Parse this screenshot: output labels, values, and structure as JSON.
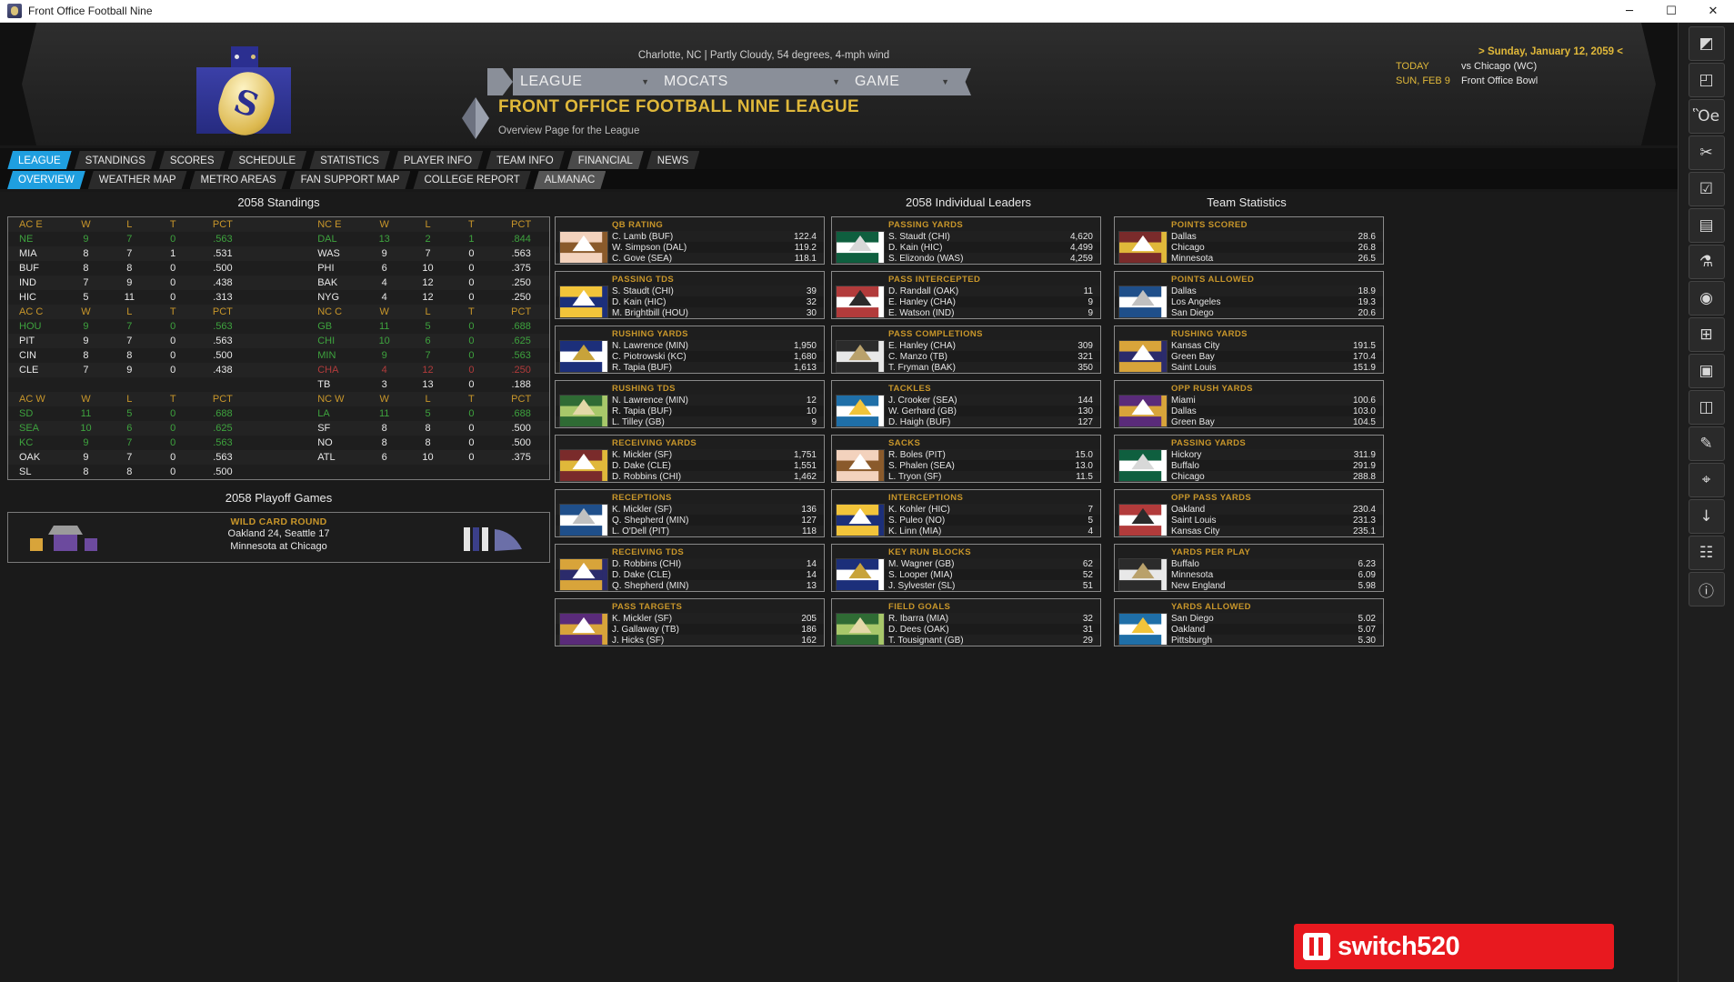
{
  "window": {
    "title": "Front Office Football Nine",
    "minimize": "─",
    "maximize": "☐",
    "close": "✕"
  },
  "header": {
    "weather": "Charlotte, NC | Partly Cloudy, 54 degrees, 4-mph wind",
    "nav": [
      {
        "label": "LEAGUE",
        "caret": "▼"
      },
      {
        "label": "MOCATS",
        "caret": "▼"
      },
      {
        "label": "GAME",
        "caret": "▼"
      }
    ],
    "league_title": "FRONT OFFICE FOOTBALL NINE LEAGUE",
    "league_sub": "Overview Page for the League",
    "date": {
      "current": "> Sunday, January 12, 2059 <",
      "rows": [
        {
          "key": "TODAY",
          "value": "vs Chicago (WC)"
        },
        {
          "key": "SUN, FEB 9",
          "value": "Front Office Bowl"
        }
      ]
    }
  },
  "tabs_primary": [
    {
      "label": "LEAGUE",
      "state": "active"
    },
    {
      "label": "STANDINGS",
      "state": "normal"
    },
    {
      "label": "SCORES",
      "state": "normal"
    },
    {
      "label": "SCHEDULE",
      "state": "normal"
    },
    {
      "label": "STATISTICS",
      "state": "normal"
    },
    {
      "label": "PLAYER INFO",
      "state": "normal"
    },
    {
      "label": "TEAM INFO",
      "state": "normal"
    },
    {
      "label": "FINANCIAL",
      "state": "hl"
    },
    {
      "label": "NEWS",
      "state": "normal"
    }
  ],
  "tabs_secondary": [
    {
      "label": "OVERVIEW",
      "state": "active"
    },
    {
      "label": "WEATHER MAP",
      "state": "normal"
    },
    {
      "label": "METRO AREAS",
      "state": "normal"
    },
    {
      "label": "FAN SUPPORT MAP",
      "state": "normal"
    },
    {
      "label": "COLLEGE REPORT",
      "state": "normal"
    },
    {
      "label": "ALMANAC",
      "state": "hl"
    }
  ],
  "standings": {
    "title": "2058 Standings",
    "columns": [
      "W",
      "L",
      "T",
      "PCT"
    ],
    "groups": [
      {
        "left": {
          "name": "AC E",
          "teams": [
            {
              "team": "NE",
              "color": "green",
              "w": "9",
              "l": "7",
              "t": "0",
              "pct": ".563"
            },
            {
              "team": "MIA",
              "color": "white",
              "w": "8",
              "l": "7",
              "t": "1",
              "pct": ".531"
            },
            {
              "team": "BUF",
              "color": "white",
              "w": "8",
              "l": "8",
              "t": "0",
              "pct": ".500"
            },
            {
              "team": "IND",
              "color": "white",
              "w": "7",
              "l": "9",
              "t": "0",
              "pct": ".438"
            },
            {
              "team": "HIC",
              "color": "white",
              "w": "5",
              "l": "11",
              "t": "0",
              "pct": ".313"
            }
          ]
        },
        "right": {
          "name": "NC E",
          "teams": [
            {
              "team": "DAL",
              "color": "green",
              "w": "13",
              "l": "2",
              "t": "1",
              "pct": ".844"
            },
            {
              "team": "WAS",
              "color": "white",
              "w": "9",
              "l": "7",
              "t": "0",
              "pct": ".563"
            },
            {
              "team": "PHI",
              "color": "white",
              "w": "6",
              "l": "10",
              "t": "0",
              "pct": ".375"
            },
            {
              "team": "BAK",
              "color": "white",
              "w": "4",
              "l": "12",
              "t": "0",
              "pct": ".250"
            },
            {
              "team": "NYG",
              "color": "white",
              "w": "4",
              "l": "12",
              "t": "0",
              "pct": ".250"
            }
          ]
        }
      },
      {
        "left": {
          "name": "AC C",
          "teams": [
            {
              "team": "HOU",
              "color": "green",
              "w": "9",
              "l": "7",
              "t": "0",
              "pct": ".563"
            },
            {
              "team": "PIT",
              "color": "white",
              "w": "9",
              "l": "7",
              "t": "0",
              "pct": ".563"
            },
            {
              "team": "CIN",
              "color": "white",
              "w": "8",
              "l": "8",
              "t": "0",
              "pct": ".500"
            },
            {
              "team": "CLE",
              "color": "white",
              "w": "7",
              "l": "9",
              "t": "0",
              "pct": ".438"
            },
            {
              "team": "",
              "color": "white",
              "w": "",
              "l": "",
              "t": "",
              "pct": ""
            }
          ]
        },
        "right": {
          "name": "NC C",
          "teams": [
            {
              "team": "GB",
              "color": "green",
              "w": "11",
              "l": "5",
              "t": "0",
              "pct": ".688"
            },
            {
              "team": "CHI",
              "color": "green",
              "w": "10",
              "l": "6",
              "t": "0",
              "pct": ".625"
            },
            {
              "team": "MIN",
              "color": "green",
              "w": "9",
              "l": "7",
              "t": "0",
              "pct": ".563"
            },
            {
              "team": "CHA",
              "color": "red",
              "w": "4",
              "l": "12",
              "t": "0",
              "pct": ".250"
            },
            {
              "team": "TB",
              "color": "white",
              "w": "3",
              "l": "13",
              "t": "0",
              "pct": ".188"
            }
          ]
        }
      },
      {
        "left": {
          "name": "AC W",
          "teams": [
            {
              "team": "SD",
              "color": "green",
              "w": "11",
              "l": "5",
              "t": "0",
              "pct": ".688"
            },
            {
              "team": "SEA",
              "color": "green",
              "w": "10",
              "l": "6",
              "t": "0",
              "pct": ".625"
            },
            {
              "team": "KC",
              "color": "green",
              "w": "9",
              "l": "7",
              "t": "0",
              "pct": ".563"
            },
            {
              "team": "OAK",
              "color": "white",
              "w": "9",
              "l": "7",
              "t": "0",
              "pct": ".563"
            },
            {
              "team": "SL",
              "color": "white",
              "w": "8",
              "l": "8",
              "t": "0",
              "pct": ".500"
            }
          ]
        },
        "right": {
          "name": "NC W",
          "teams": [
            {
              "team": "LA",
              "color": "green",
              "w": "11",
              "l": "5",
              "t": "0",
              "pct": ".688"
            },
            {
              "team": "SF",
              "color": "white",
              "w": "8",
              "l": "8",
              "t": "0",
              "pct": ".500"
            },
            {
              "team": "NO",
              "color": "white",
              "w": "8",
              "l": "8",
              "t": "0",
              "pct": ".500"
            },
            {
              "team": "ATL",
              "color": "white",
              "w": "6",
              "l": "10",
              "t": "0",
              "pct": ".375"
            },
            {
              "team": "",
              "color": "white",
              "w": "",
              "l": "",
              "t": "",
              "pct": ""
            }
          ]
        }
      }
    ]
  },
  "playoffs": {
    "title": "2058 Playoff Games",
    "round": "WILD CARD ROUND",
    "games": [
      "Oakland 24, Seattle 17",
      "Minnesota at Chicago"
    ]
  },
  "leaders": {
    "title": "2058 Individual Leaders",
    "column1": [
      {
        "category": "QB RATING",
        "rows": [
          {
            "name": "C. Lamb (BUF)",
            "value": "122.4"
          },
          {
            "name": "W. Simpson (DAL)",
            "value": "119.2"
          },
          {
            "name": "C. Gove (SEA)",
            "value": "118.1"
          }
        ]
      },
      {
        "category": "PASSING TDS",
        "rows": [
          {
            "name": "S. Staudt (CHI)",
            "value": "39"
          },
          {
            "name": "D. Kain (HIC)",
            "value": "32"
          },
          {
            "name": "M. Brightbill (HOU)",
            "value": "30"
          }
        ]
      },
      {
        "category": "RUSHING YARDS",
        "rows": [
          {
            "name": "N. Lawrence (MIN)",
            "value": "1,950"
          },
          {
            "name": "C. Piotrowski (KC)",
            "value": "1,680"
          },
          {
            "name": "R. Tapia (BUF)",
            "value": "1,613"
          }
        ]
      },
      {
        "category": "RUSHING TDS",
        "rows": [
          {
            "name": "N. Lawrence (MIN)",
            "value": "12"
          },
          {
            "name": "R. Tapia (BUF)",
            "value": "10"
          },
          {
            "name": "L. Tilley (GB)",
            "value": "9"
          }
        ]
      },
      {
        "category": "RECEIVING YARDS",
        "rows": [
          {
            "name": "K. Mickler (SF)",
            "value": "1,751"
          },
          {
            "name": "D. Dake (CLE)",
            "value": "1,551"
          },
          {
            "name": "D. Robbins (CHI)",
            "value": "1,462"
          }
        ]
      },
      {
        "category": "RECEPTIONS",
        "rows": [
          {
            "name": "K. Mickler (SF)",
            "value": "136"
          },
          {
            "name": "Q. Shepherd (MIN)",
            "value": "127"
          },
          {
            "name": "L. O'Dell (PIT)",
            "value": "118"
          }
        ]
      },
      {
        "category": "RECEIVING TDS",
        "rows": [
          {
            "name": "D. Robbins (CHI)",
            "value": "14"
          },
          {
            "name": "D. Dake (CLE)",
            "value": "14"
          },
          {
            "name": "Q. Shepherd (MIN)",
            "value": "13"
          }
        ]
      },
      {
        "category": "PASS TARGETS",
        "rows": [
          {
            "name": "K. Mickler (SF)",
            "value": "205"
          },
          {
            "name": "J. Gallaway (TB)",
            "value": "186"
          },
          {
            "name": "J. Hicks (SF)",
            "value": "162"
          }
        ]
      }
    ],
    "column2": [
      {
        "category": "PASSING YARDS",
        "rows": [
          {
            "name": "S. Staudt (CHI)",
            "value": "4,620"
          },
          {
            "name": "D. Kain (HIC)",
            "value": "4,499"
          },
          {
            "name": "S. Elizondo (WAS)",
            "value": "4,259"
          }
        ]
      },
      {
        "category": "PASS INTERCEPTED",
        "rows": [
          {
            "name": "D. Randall (OAK)",
            "value": "11"
          },
          {
            "name": "E. Hanley (CHA)",
            "value": "9"
          },
          {
            "name": "E. Watson (IND)",
            "value": "9"
          }
        ]
      },
      {
        "category": "PASS COMPLETIONS",
        "rows": [
          {
            "name": "E. Hanley (CHA)",
            "value": "309"
          },
          {
            "name": "C. Manzo (TB)",
            "value": "321"
          },
          {
            "name": "T. Fryman (BAK)",
            "value": "350"
          }
        ]
      },
      {
        "category": "TACKLES",
        "rows": [
          {
            "name": "J. Crooker (SEA)",
            "value": "144"
          },
          {
            "name": "W. Gerhard (GB)",
            "value": "130"
          },
          {
            "name": "D. Haigh (BUF)",
            "value": "127"
          }
        ]
      },
      {
        "category": "SACKS",
        "rows": [
          {
            "name": "R. Boles (PIT)",
            "value": "15.0"
          },
          {
            "name": "S. Phalen (SEA)",
            "value": "13.0"
          },
          {
            "name": "L. Tryon (SF)",
            "value": "11.5"
          }
        ]
      },
      {
        "category": "INTERCEPTIONS",
        "rows": [
          {
            "name": "K. Kohler (HIC)",
            "value": "7"
          },
          {
            "name": "S. Puleo (NO)",
            "value": "5"
          },
          {
            "name": "K. Linn (MIA)",
            "value": "4"
          }
        ]
      },
      {
        "category": "KEY RUN BLOCKS",
        "rows": [
          {
            "name": "M. Wagner (GB)",
            "value": "62"
          },
          {
            "name": "S. Looper (MIA)",
            "value": "52"
          },
          {
            "name": "J. Sylvester (SL)",
            "value": "51"
          }
        ]
      },
      {
        "category": "FIELD GOALS",
        "rows": [
          {
            "name": "R. Ibarra (MIA)",
            "value": "32"
          },
          {
            "name": "D. Dees (OAK)",
            "value": "31"
          },
          {
            "name": "T. Tousignant (GB)",
            "value": "29"
          }
        ]
      }
    ]
  },
  "team_statistics": {
    "title": "Team Statistics",
    "boxes": [
      {
        "category": "POINTS SCORED",
        "rows": [
          {
            "name": "Dallas",
            "value": "28.6"
          },
          {
            "name": "Chicago",
            "value": "26.8"
          },
          {
            "name": "Minnesota",
            "value": "26.5"
          }
        ]
      },
      {
        "category": "POINTS ALLOWED",
        "rows": [
          {
            "name": "Dallas",
            "value": "18.9"
          },
          {
            "name": "Los Angeles",
            "value": "19.3"
          },
          {
            "name": "San Diego",
            "value": "20.6"
          }
        ]
      },
      {
        "category": "RUSHING YARDS",
        "rows": [
          {
            "name": "Kansas City",
            "value": "191.5"
          },
          {
            "name": "Green Bay",
            "value": "170.4"
          },
          {
            "name": "Saint Louis",
            "value": "151.9"
          }
        ]
      },
      {
        "category": "OPP RUSH YARDS",
        "rows": [
          {
            "name": "Miami",
            "value": "100.6"
          },
          {
            "name": "Dallas",
            "value": "103.0"
          },
          {
            "name": "Green Bay",
            "value": "104.5"
          }
        ]
      },
      {
        "category": "PASSING YARDS",
        "rows": [
          {
            "name": "Hickory",
            "value": "311.9"
          },
          {
            "name": "Buffalo",
            "value": "291.9"
          },
          {
            "name": "Chicago",
            "value": "288.8"
          }
        ]
      },
      {
        "category": "OPP PASS YARDS",
        "rows": [
          {
            "name": "Oakland",
            "value": "230.4"
          },
          {
            "name": "Saint Louis",
            "value": "231.3"
          },
          {
            "name": "Kansas City",
            "value": "235.1"
          }
        ]
      },
      {
        "category": "YARDS PER PLAY",
        "rows": [
          {
            "name": "Buffalo",
            "value": "6.23"
          },
          {
            "name": "Minnesota",
            "value": "6.09"
          },
          {
            "name": "New England",
            "value": "5.98"
          }
        ]
      },
      {
        "category": "YARDS ALLOWED",
        "rows": [
          {
            "name": "San Diego",
            "value": "5.02"
          },
          {
            "name": "Oakland",
            "value": "5.07"
          },
          {
            "name": "Pittsburgh",
            "value": "5.30"
          }
        ]
      }
    ]
  },
  "toolbar_rail": [
    {
      "icon": "◩",
      "name": "panel-icon"
    },
    {
      "icon": "◰",
      "name": "layout-icon"
    },
    {
      "icon": "Ὃe",
      "name": "save-icon"
    },
    {
      "icon": "✂",
      "name": "scissors-icon"
    },
    {
      "icon": "☑",
      "name": "checklist-icon"
    },
    {
      "icon": "▤",
      "name": "book-icon"
    },
    {
      "icon": "⚗",
      "name": "trophy-icon"
    },
    {
      "icon": "◉",
      "name": "eye-icon"
    },
    {
      "icon": "⊞",
      "name": "grid-icon"
    },
    {
      "icon": "▣",
      "name": "calendar-icon"
    },
    {
      "icon": "◫",
      "name": "table-icon"
    },
    {
      "icon": "✎",
      "name": "edit-icon"
    },
    {
      "icon": "⌖",
      "name": "target-icon"
    },
    {
      "icon": "↓",
      "name": "download-icon"
    },
    {
      "icon": "☷",
      "name": "chart-icon"
    },
    {
      "icon": "ⓘ",
      "name": "info-icon"
    }
  ],
  "watermark": {
    "text": "switch520"
  }
}
